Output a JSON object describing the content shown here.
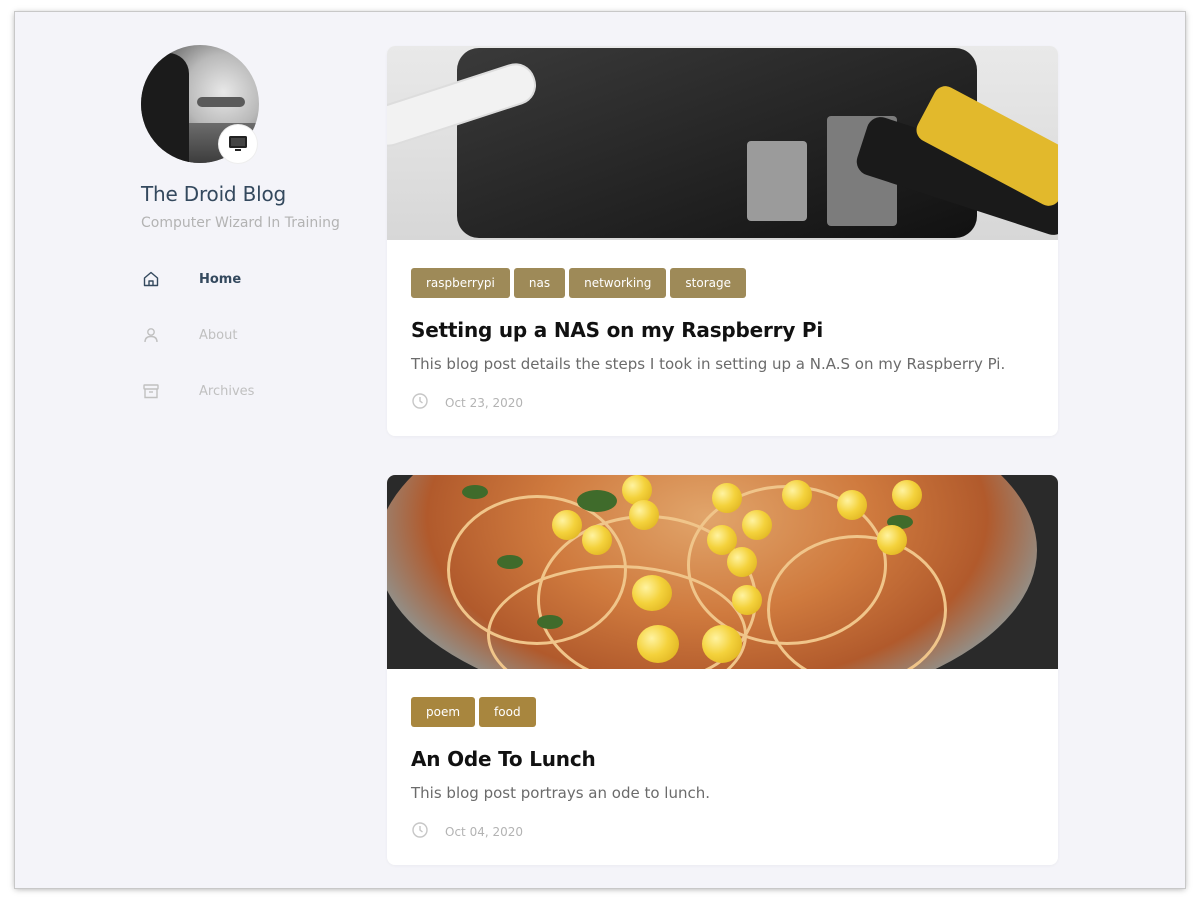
{
  "blog": {
    "title": "The Droid Blog",
    "subtitle": "Computer Wizard In Training",
    "avatar_badge_icon": "monitor-icon"
  },
  "nav": [
    {
      "label": "Home",
      "icon": "home-icon",
      "active": true
    },
    {
      "label": "About",
      "icon": "user-icon",
      "active": false
    },
    {
      "label": "Archives",
      "icon": "archive-icon",
      "active": false
    }
  ],
  "posts": [
    {
      "tags": [
        "raspberrypi",
        "nas",
        "networking",
        "storage"
      ],
      "title": "Setting up a NAS on my Raspberry Pi",
      "excerpt": "This blog post details the steps I took in setting up a N.A.S on my Raspberry Pi.",
      "date": "Oct 23, 2020",
      "date_icon": "clock-icon"
    },
    {
      "tags": [
        "poem",
        "food"
      ],
      "title": "An Ode To Lunch",
      "excerpt": "This blog post portrays an ode to lunch.",
      "date": "Oct 04, 2020",
      "date_icon": "clock-icon"
    }
  ],
  "colors": {
    "page_bg": "#f4f4f9",
    "title": "#34495e",
    "tag_1": "#9e8a58",
    "tag_2": "#a8863e"
  }
}
